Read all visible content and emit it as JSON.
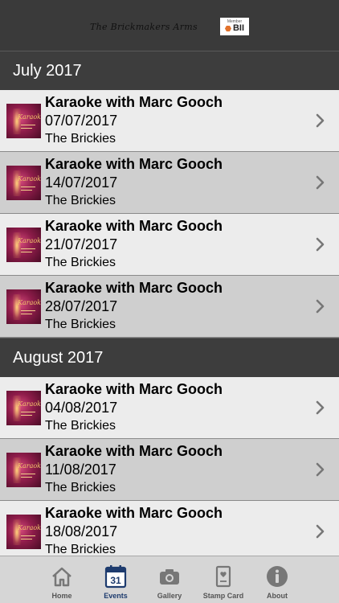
{
  "header": {
    "venue_logo_text": "The Brickmakers Arms",
    "badge_top": "Member",
    "badge_main": "BII"
  },
  "sections": [
    {
      "month": "July 2017",
      "events": [
        {
          "title": "Karaoke with Marc Gooch",
          "date": "07/07/2017",
          "venue": "The Brickies"
        },
        {
          "title": "Karaoke with Marc Gooch",
          "date": "14/07/2017",
          "venue": "The Brickies"
        },
        {
          "title": "Karaoke with Marc Gooch",
          "date": "21/07/2017",
          "venue": "The Brickies"
        },
        {
          "title": "Karaoke with Marc Gooch",
          "date": "28/07/2017",
          "venue": "The Brickies"
        }
      ]
    },
    {
      "month": "August 2017",
      "events": [
        {
          "title": "Karaoke with Marc Gooch",
          "date": "04/08/2017",
          "venue": "The Brickies"
        },
        {
          "title": "Karaoke with Marc Gooch",
          "date": "11/08/2017",
          "venue": "The Brickies"
        },
        {
          "title": "Karaoke with Marc Gooch",
          "date": "18/08/2017",
          "venue": "The Brickies"
        }
      ]
    }
  ],
  "tabs": [
    {
      "label": "Home",
      "icon": "home-icon"
    },
    {
      "label": "Events",
      "icon": "calendar-icon",
      "calendar_day": "31",
      "active": true
    },
    {
      "label": "Gallery",
      "icon": "camera-icon"
    },
    {
      "label": "Stamp Card",
      "icon": "stamp-card-icon"
    },
    {
      "label": "About",
      "icon": "info-icon"
    }
  ],
  "colors": {
    "header_bg": "#3a3a3a",
    "section_bg": "#3d3d3d",
    "row_light": "#ececec",
    "row_dark": "#cfcfcf",
    "tab_active": "#1d3b6e"
  }
}
